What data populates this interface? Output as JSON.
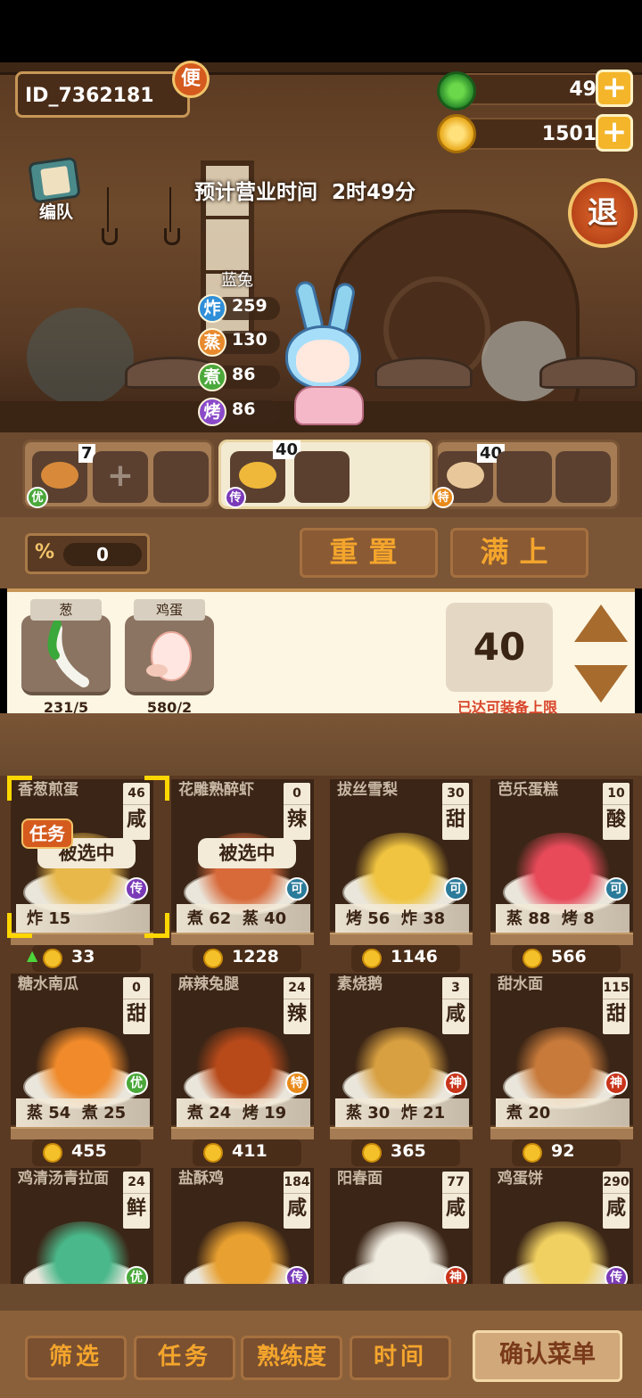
{
  "header": {
    "player_id": "ID_7362181",
    "badge": "便",
    "jade": "49",
    "coins": "1501",
    "team_label": "编队",
    "exit_label": "退",
    "business_time": "预计营业时间  2时49分"
  },
  "character": {
    "name": "蓝兔",
    "stats": [
      {
        "icon": "炸",
        "value": "259",
        "color": "#2f8fd8"
      },
      {
        "icon": "蒸",
        "value": "130",
        "color": "#e88a2c"
      },
      {
        "icon": "煮",
        "value": "86",
        "color": "#4aa83a"
      },
      {
        "icon": "烤",
        "value": "86",
        "color": "#8a4ac8"
      }
    ]
  },
  "slots": [
    {
      "count": "7",
      "rarity": "优"
    },
    {
      "count": "40",
      "rarity": "传"
    },
    {
      "count": "40",
      "rarity": "特"
    }
  ],
  "controls": {
    "percent_icon": "%",
    "percent_value": "0",
    "reset_label": "重置",
    "fill_label": "满上"
  },
  "ingredients": [
    {
      "name": "葱",
      "count": "231/5"
    },
    {
      "name": "鸡蛋",
      "count": "580/2"
    }
  ],
  "quantity": {
    "value": "40",
    "limit_text": "已达可装备上限"
  },
  "recipes": [
    {
      "name": "香葱煎蛋",
      "num": "46",
      "flavor": "咸",
      "rarity": "传",
      "attrs": "炸 15",
      "price": "33",
      "selected_text": "被选中",
      "task": "任务",
      "up": true,
      "color": "#e8b84a"
    },
    {
      "name": "花雕熟醉虾",
      "num": "0",
      "flavor": "辣",
      "rarity": "可",
      "attrs": "煮 62  蒸 40",
      "price": "1228",
      "selected_text": "被选中",
      "color": "#d86a3a"
    },
    {
      "name": "拔丝雪梨",
      "num": "30",
      "flavor": "甜",
      "rarity": "可",
      "attrs": "烤 56  炸 38",
      "price": "1146",
      "color": "#f0c440"
    },
    {
      "name": "芭乐蛋糕",
      "num": "10",
      "flavor": "酸",
      "rarity": "可",
      "attrs": "蒸 88  烤 8",
      "price": "566",
      "color": "#e84a5a"
    },
    {
      "name": "糖水南瓜",
      "num": "0",
      "flavor": "甜",
      "rarity": "优",
      "attrs": "蒸 54  煮 25",
      "price": "455",
      "color": "#f08a2a"
    },
    {
      "name": "麻辣兔腿",
      "num": "24",
      "flavor": "辣",
      "rarity": "特",
      "attrs": "煮 24  烤 19",
      "price": "411",
      "color": "#b84a1a"
    },
    {
      "name": "素烧鹅",
      "num": "3",
      "flavor": "咸",
      "rarity": "神",
      "attrs": "蒸 30  炸 21",
      "price": "365",
      "color": "#d8a040"
    },
    {
      "name": "甜水面",
      "num": "115",
      "flavor": "甜",
      "rarity": "神",
      "attrs": "煮 20",
      "price": "92",
      "color": "#c87a3a"
    },
    {
      "name": "鸡清汤青拉面",
      "num": "24",
      "flavor": "鲜",
      "rarity": "优",
      "color": "#4ab88a"
    },
    {
      "name": "盐酥鸡",
      "num": "184",
      "flavor": "咸",
      "rarity": "传",
      "color": "#e8a030"
    },
    {
      "name": "阳春面",
      "num": "77",
      "flavor": "咸",
      "rarity": "神",
      "color": "#f0ece0"
    },
    {
      "name": "鸡蛋饼",
      "num": "290",
      "flavor": "咸",
      "rarity": "传",
      "color": "#f0d060"
    }
  ],
  "rarity_colors": {
    "优": "#4aa83a",
    "传": "#7a3ab8",
    "可": "#2a7a9a",
    "特": "#e88a1a",
    "神": "#c8341a"
  },
  "bottom": {
    "filter": "筛选",
    "task": "任务",
    "proficiency": "熟练度",
    "time": "时间",
    "confirm": "确认菜单"
  }
}
